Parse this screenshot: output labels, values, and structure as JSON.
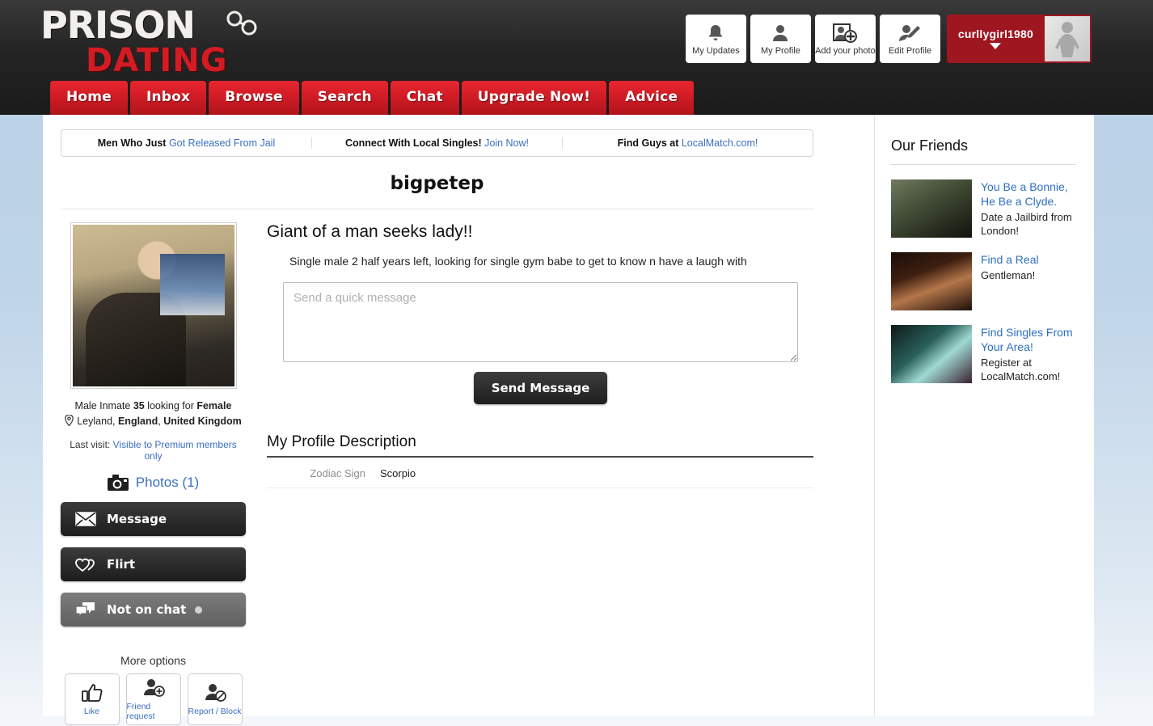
{
  "site": {
    "logo_line1": "PRISON",
    "logo_line2": "DATING"
  },
  "header": {
    "buttons": [
      {
        "label": "My Updates",
        "icon": "bell-icon"
      },
      {
        "label": "My Profile",
        "icon": "person-icon"
      },
      {
        "label": "Add your photo",
        "icon": "add-photo-icon"
      },
      {
        "label": "Edit Profile",
        "icon": "edit-profile-icon"
      }
    ],
    "user": {
      "name": "curllygirl1980",
      "avatar_icon": "female-silhouette-avatar"
    }
  },
  "nav": {
    "items": [
      "Home",
      "Inbox",
      "Browse",
      "Search",
      "Chat",
      "Upgrade Now!",
      "Advice"
    ]
  },
  "ads": [
    {
      "text": "Men Who Just ",
      "link": "Got Released From Jail"
    },
    {
      "text": "Connect With Local Singles! ",
      "link": "Join Now!"
    },
    {
      "text": "Find Guys at ",
      "link": "LocalMatch.com!"
    }
  ],
  "profile": {
    "username": "bigpetep",
    "headline": "Giant of a man seeks lady!!",
    "description": "Single male 2 half years left, looking for single gym babe to get to know n have a laugh with",
    "gender_line_prefix": "Male Inmate ",
    "age": "35",
    "gender_line_mid": " looking for ",
    "seeking": "Female",
    "location_city": "Leyland, ",
    "location_region": "England",
    "location_sep": ", ",
    "location_country": "United Kingdom",
    "last_visit_label": "Last visit: ",
    "last_visit_value": "Visible to Premium members only",
    "photos_label": "Photos (1)",
    "photo_alt": "bigpetep profile photo"
  },
  "actions": {
    "message": "Message",
    "flirt": "Flirt",
    "chat_status": "Not on chat",
    "more_options": "More options",
    "options": [
      {
        "label": "Like",
        "icon": "thumbs-up-icon"
      },
      {
        "label": "Friend request",
        "icon": "add-person-icon"
      },
      {
        "label": "Report / Block",
        "icon": "block-person-icon"
      }
    ]
  },
  "quick_message": {
    "placeholder": "Send a quick message",
    "value": "",
    "send_label": "Send Message"
  },
  "profile_description": {
    "title": "My Profile Description",
    "rows": [
      {
        "key": "Zodiac Sign",
        "value": "Scorpio"
      }
    ]
  },
  "friends": {
    "title": "Our Friends",
    "items": [
      {
        "link": "You Be a Bonnie, He Be a Clyde.",
        "sub": "Date a Jailbird from London!"
      },
      {
        "link": "Find a Real",
        "sub": "Gentleman!"
      },
      {
        "link": "Find Singles From Your Area!",
        "sub": "Register at LocalMatch.com!"
      }
    ]
  },
  "colors": {
    "brand_red": "#cf1b24",
    "user_box_red": "#9e1620",
    "link_blue": "#3a6fbf",
    "header_dark": "#242424",
    "page_bg": "#b9d1e7"
  }
}
